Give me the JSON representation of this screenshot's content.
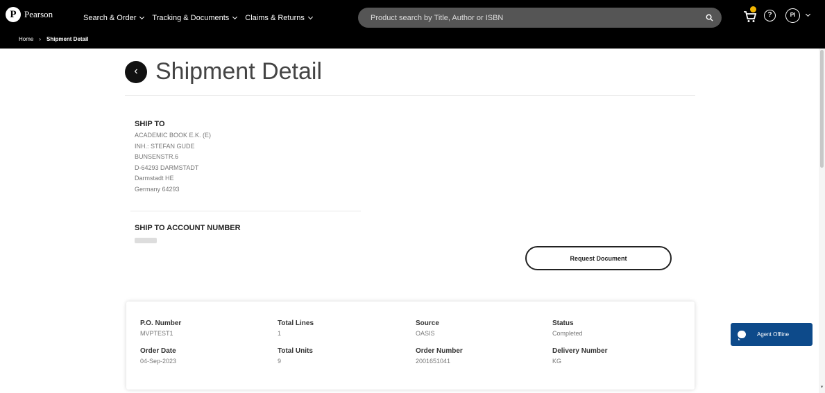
{
  "header": {
    "logo_text": "Pearson",
    "logo_mark": "P",
    "nav": [
      {
        "label": "Search & Order"
      },
      {
        "label": "Tracking & Documents"
      },
      {
        "label": "Claims & Returns"
      }
    ],
    "search_placeholder": "Product search by Title, Author or ISBN",
    "help_glyph": "?",
    "avatar_initials": "PI"
  },
  "breadcrumb": {
    "home": "Home",
    "separator": "›",
    "current": "Shipment Detail"
  },
  "page": {
    "back_glyph": "‹",
    "title": "Shipment Detail"
  },
  "ship_to": {
    "label": "SHIP TO",
    "lines": [
      "ACADEMIC BOOK E.K. (E)",
      "INH.: STEFAN GUDE",
      "BUNSENSTR.6",
      "D-64293 DARMSTADT",
      "Darmstadt HE",
      "Germany 64293"
    ]
  },
  "account": {
    "label": "SHIP TO ACCOUNT NUMBER"
  },
  "actions": {
    "request_document": "Request Document"
  },
  "details": {
    "po_number": {
      "label": "P.O. Number",
      "value": "MVPTEST1"
    },
    "total_lines": {
      "label": "Total Lines",
      "value": "1"
    },
    "source": {
      "label": "Source",
      "value": "OASIS"
    },
    "status": {
      "label": "Status",
      "value": "Completed"
    },
    "order_date": {
      "label": "Order Date",
      "value": "04-Sep-2023"
    },
    "total_units": {
      "label": "Total Units",
      "value": "9"
    },
    "order_number": {
      "label": "Order Number",
      "value": "2001651041"
    },
    "delivery_number": {
      "label": "Delivery Number",
      "value": "KG"
    }
  },
  "chat": {
    "label": "Agent Offline"
  },
  "colors": {
    "topbar": "#000000",
    "chat_button": "#0d4a8a",
    "cart_badge": "#f0b400"
  }
}
